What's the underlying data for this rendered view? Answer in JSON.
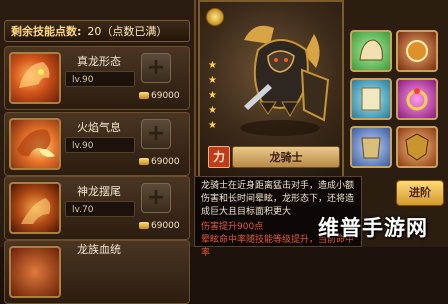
{
  "points": {
    "label": "剩余技能点数:",
    "value": "20（点数已满）"
  },
  "skills": [
    {
      "name": "真龙形态",
      "level": "lv.90",
      "cost": "69000",
      "plus": "+"
    },
    {
      "name": "火焰气息",
      "level": "lv.90",
      "cost": "69000",
      "plus": "+"
    },
    {
      "name": "神龙摆尾",
      "level": "lv.70",
      "cost": "69000",
      "plus": "+"
    },
    {
      "name": "龙族血统",
      "level": "",
      "cost": "",
      "plus": ""
    }
  ],
  "character": {
    "name": "龙骑士",
    "power_badge": "力",
    "stars": 5
  },
  "equipment": [
    {
      "slot": "helmet",
      "border_color": "#caa35a",
      "bg": "#6fd06a"
    },
    {
      "slot": "amulet",
      "border_color": "#caa35a",
      "bg": "#b14a2a"
    },
    {
      "slot": "scroll",
      "border_color": "#caa35a",
      "bg": "#3fb3c9"
    },
    {
      "slot": "ring",
      "border_color": "#caa35a",
      "bg": "#c23fb3"
    },
    {
      "slot": "armor",
      "border_color": "#caa35a",
      "bg": "#6a8cd6"
    },
    {
      "slot": "shield",
      "border_color": "#caa35a",
      "bg": "#c46a2a"
    }
  ],
  "advance_label": "进阶",
  "tooltip": {
    "description": "龙骑士在近身距离猛击对手，造成小额伤害和长时间晕眩，龙形态下，还将造成巨大且目标面积更大",
    "bonus_line1": "伤害提升900点",
    "bonus_line2": "晕眩命中率随技能等级提升，当前命中率"
  },
  "watermark": "维普手游网",
  "colors": {
    "accent": "#caa35a",
    "damage": "#e4572e",
    "gold": "#ffd247"
  }
}
